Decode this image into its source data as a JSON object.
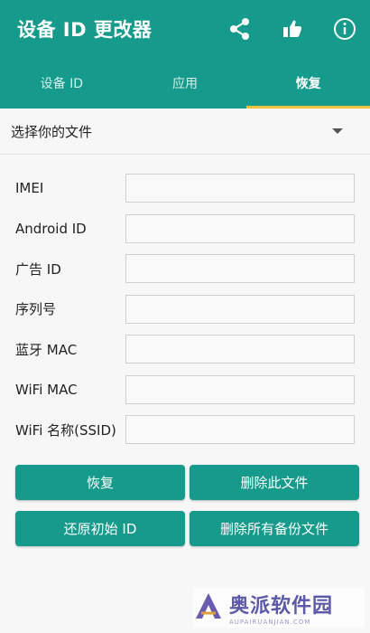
{
  "app": {
    "title": "设备 ID 更改器",
    "accent_color": "#159a8b",
    "tab_indicator_color": "#f1c23a",
    "actions": [
      {
        "name": "share-icon"
      },
      {
        "name": "thumbs-up-icon"
      },
      {
        "name": "info-icon"
      }
    ]
  },
  "tabs": [
    {
      "label": "设备 ID",
      "active": false
    },
    {
      "label": "应用",
      "active": false
    },
    {
      "label": "恢复",
      "active": true
    }
  ],
  "file_selector": {
    "label": "选择你的文件"
  },
  "fields": [
    {
      "label": "IMEI",
      "value": ""
    },
    {
      "label": "Android ID",
      "value": ""
    },
    {
      "label": "广告 ID",
      "value": ""
    },
    {
      "label": "序列号",
      "value": ""
    },
    {
      "label": "蓝牙 MAC",
      "value": ""
    },
    {
      "label": "WiFi MAC",
      "value": ""
    },
    {
      "label": "WiFi 名称(SSID)",
      "value": ""
    }
  ],
  "buttons": {
    "restore": "恢复",
    "delete_file": "删除此文件",
    "reset_original_id": "还原初始 ID",
    "delete_all_backups": "删除所有备份文件"
  },
  "watermark": {
    "text": "奥派软件园",
    "sub": "AUPAIRUANJIAN.COM"
  }
}
